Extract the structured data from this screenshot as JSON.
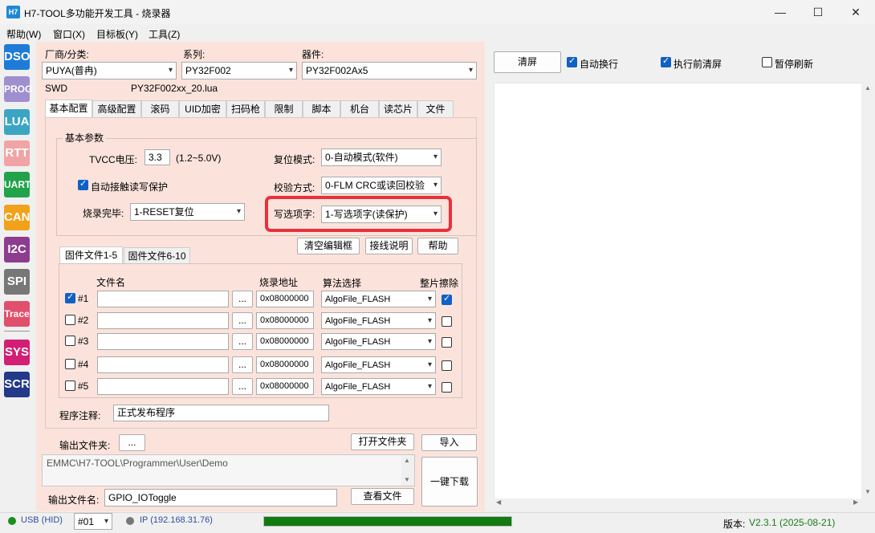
{
  "window": {
    "logo": "H7",
    "title": "H7-TOOL多功能开发工具 - 烧录器",
    "controls": {
      "minimize": "—",
      "maximize": "☐",
      "close": "✕"
    }
  },
  "menubar": [
    "帮助(W)",
    "窗口(X)",
    "目标板(Y)",
    "工具(Z)"
  ],
  "sidebar": [
    {
      "label": "DSO",
      "color": "#1f7bd8"
    },
    {
      "label": "PROG",
      "color": "#a08fce"
    },
    {
      "label": "LUA",
      "color": "#3aa6c2"
    },
    {
      "label": "RTT",
      "color": "#f0a4a4"
    },
    {
      "label": "UART",
      "color": "#22a34a"
    },
    {
      "label": "CAN",
      "color": "#f2a11a"
    },
    {
      "label": "I2C",
      "color": "#8d3d8f"
    },
    {
      "label": "SPI",
      "color": "#777777"
    },
    {
      "label": "Trace",
      "color": "#e0506c"
    },
    {
      "label": "SYS",
      "color": "#d21e74"
    },
    {
      "label": "SCR",
      "color": "#233a8a"
    }
  ],
  "selectors": {
    "vendor_label": "厂商/分类:",
    "vendor_value": "PUYA(普冉)",
    "series_label": "系列:",
    "series_value": "PY32F002",
    "device_label": "器件:",
    "device_value": "PY32F002Ax5",
    "interface": "SWD",
    "lua_file": "PY32F002xx_20.lua"
  },
  "tabs": [
    "基本配置",
    "高级配置",
    "滚码",
    "UID加密",
    "扫码枪",
    "限制",
    "脚本",
    "机台",
    "读芯片",
    "文件"
  ],
  "basic": {
    "group_title": "基本参数",
    "tvcc_label": "TVCC电压:",
    "tvcc_value": "3.3",
    "tvcc_range": "(1.2~5.0V)",
    "auto_protect_label": "自动接触读写保护",
    "burn_done_label": "烧录完毕:",
    "burn_done_value": "1-RESET复位",
    "reset_mode_label": "复位模式:",
    "reset_mode_value": "0-自动模式(软件)",
    "verify_label": "校验方式:",
    "verify_value": "0-FLM CRC或读回校验",
    "option_label": "写选项字:",
    "option_value": "1-写选项字(读保护)"
  },
  "buttons": {
    "clear_editor": "清空编辑框",
    "wiring": "接线说明",
    "help": "帮助",
    "open_folder": "打开文件夹",
    "import": "导入",
    "view_file": "查看文件",
    "one_key": "一键下载",
    "browse": "...",
    "clear_screen": "清屏"
  },
  "file_tabs": [
    "固件文件1-5",
    "固件文件6-10"
  ],
  "file_table": {
    "headers": {
      "name": "文件名",
      "addr": "烧录地址",
      "algo": "算法选择",
      "erase": "整片擦除"
    },
    "rows": [
      {
        "index": "#1",
        "checked": true,
        "addr": "0x08000000",
        "algo": "AlgoFile_FLASH",
        "erase": true
      },
      {
        "index": "#2",
        "checked": false,
        "addr": "0x08000000",
        "algo": "AlgoFile_FLASH",
        "erase": false
      },
      {
        "index": "#3",
        "checked": false,
        "addr": "0x08000000",
        "algo": "AlgoFile_FLASH",
        "erase": false
      },
      {
        "index": "#4",
        "checked": false,
        "addr": "0x08000000",
        "algo": "AlgoFile_FLASH",
        "erase": false
      },
      {
        "index": "#5",
        "checked": false,
        "addr": "0x08000000",
        "algo": "AlgoFile_FLASH",
        "erase": false
      }
    ]
  },
  "note": {
    "label": "程序注释:",
    "value": "正式发布程序"
  },
  "output": {
    "folder_label": "输出文件夹:",
    "folder_path": "EMMC\\H7-TOOL\\Programmer\\User\\Demo",
    "filename_label": "输出文件名:",
    "filename_value": "GPIO_IOToggle"
  },
  "right": {
    "auto_wrap": "自动换行",
    "auto_wrap_checked": true,
    "clear_before": "执行前清屏",
    "clear_before_checked": true,
    "pause_refresh": "暂停刷新",
    "pause_refresh_checked": false
  },
  "status": {
    "usb": "USB (HID)",
    "usb_color": "#1a8f1a",
    "port": "#01",
    "ip": "IP (192.168.31.76)",
    "ip_color": "#777777",
    "progress": 1.0,
    "version_label": "版本:",
    "version_value": "V2.3.1 (2025-08-21)"
  }
}
